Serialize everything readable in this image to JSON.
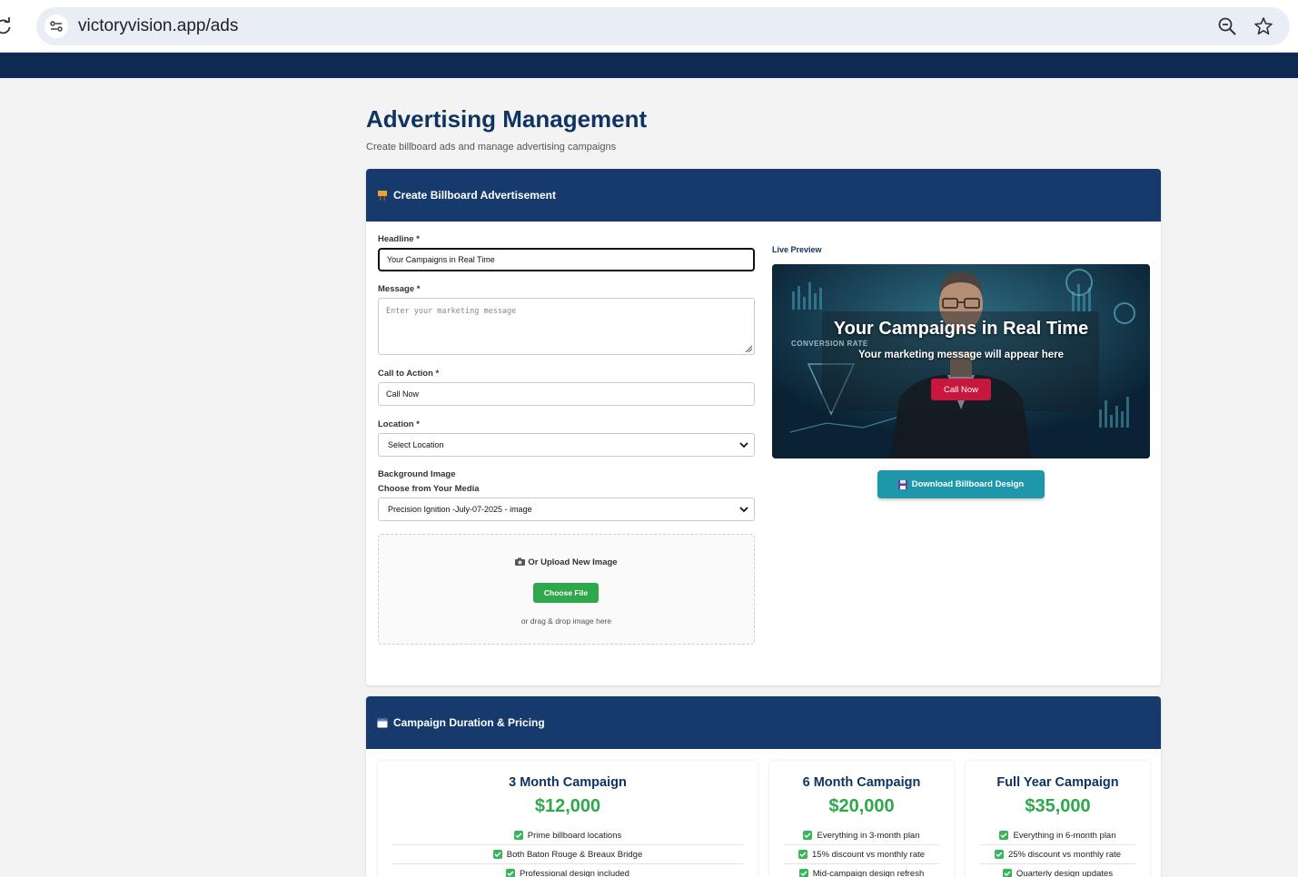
{
  "browser": {
    "url": "victoryvision.app/ads"
  },
  "page": {
    "title": "Advertising Management",
    "subtitle": "Create billboard ads and manage advertising campaigns"
  },
  "billboard_card": {
    "title": "Create Billboard Advertisement",
    "headline_label": "Headline *",
    "headline_value": "Your Campaigns in Real Time",
    "message_label": "Message *",
    "message_placeholder": "Enter your marketing message",
    "cta_label": "Call to Action *",
    "cta_value": "Call Now",
    "location_label": "Location *",
    "location_value": "Select Location",
    "background_label": "Background Image",
    "media_label": "Choose from Your Media",
    "media_value": "Precision Ignition -July-07-2025 - image",
    "upload_title": "Or Upload New Image",
    "choose_file": "Choose File",
    "drag_text": "or drag & drop image here",
    "preview_label": "Live Preview",
    "preview": {
      "headline": "Your Campaigns in Real Time",
      "message": "Your marketing message will appear here",
      "cta": "Call Now",
      "bg_text": "CONVERSION RATE"
    },
    "download_button": "Download Billboard Design"
  },
  "pricing_card": {
    "title": "Campaign Duration & Pricing",
    "plans": [
      {
        "name": "3 Month Campaign",
        "price": "$12,000",
        "features": [
          "Prime billboard locations",
          "Both Baton Rouge & Breaux Bridge",
          "Professional design included"
        ]
      },
      {
        "name": "6 Month Campaign",
        "price": "$20,000",
        "features": [
          "Everything in 3-month plan",
          "15% discount vs monthly rate",
          "Mid-campaign design refresh"
        ]
      },
      {
        "name": "Full Year Campaign",
        "price": "$35,000",
        "features": [
          "Everything in 6-month plan",
          "25% discount vs monthly rate",
          "Quarterly design updates"
        ]
      }
    ]
  },
  "colors": {
    "navy": "#153a6b",
    "title_blue": "#0f3462",
    "green": "#2ea84a",
    "teal": "#1f97aa",
    "cta_red": "#c8163f"
  }
}
